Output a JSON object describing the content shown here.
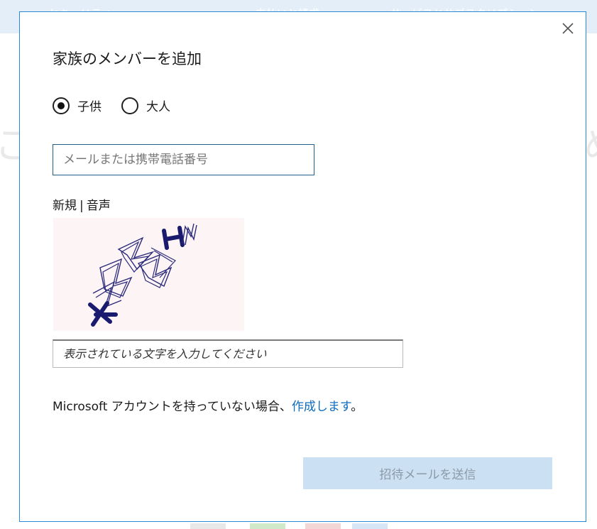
{
  "dialog": {
    "title": "家族のメンバーを追加",
    "close_label": "×",
    "member_type": {
      "options": [
        {
          "label": "子供",
          "selected": true
        },
        {
          "label": "大人",
          "selected": false
        }
      ]
    },
    "email": {
      "placeholder": "メールまたは携帯電話番号",
      "value": ""
    },
    "captcha": {
      "new_label": "新規",
      "separator": "|",
      "audio_label": "音声",
      "input_placeholder": "表示されている文字を入力してください",
      "input_value": ""
    },
    "account": {
      "text": "Microsoft アカウントを持っていない場合、",
      "link_label": "作成します",
      "suffix": "。"
    },
    "send_button_label": "招待メールを送信"
  },
  "colors": {
    "dialog_border": "#2b88d8",
    "link": "#0f6cbd",
    "button_disabled_bg": "#cce0f3",
    "button_disabled_text": "#8a9aa8",
    "captcha_ink": "#1a1a6e"
  }
}
